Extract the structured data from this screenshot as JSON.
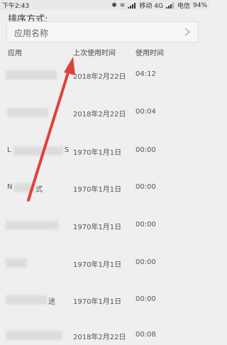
{
  "status_bar": {
    "time": "下午2:43",
    "carrier1": "移动 4G",
    "carrier2": "电信",
    "battery": "94%"
  },
  "sort": {
    "label": "排序方式:",
    "selected": "应用名称"
  },
  "columns": {
    "app": "应用",
    "last_used": "上次使用时间",
    "duration": "使用时间"
  },
  "rows": [
    {
      "name_visible": "",
      "date": "2018年2月22日",
      "duration": "04:12"
    },
    {
      "name_visible": "",
      "date": "2018年2月22日",
      "duration": "00:04"
    },
    {
      "name_visible": "L",
      "name_suffix": "S",
      "date": "1970年1月1日",
      "duration": "00:00"
    },
    {
      "name_visible": "N",
      "name_suffix": "式",
      "date": "1970年1月1日",
      "duration": "00:00"
    },
    {
      "name_visible": "",
      "date": "1970年1月1日",
      "duration": "00:00"
    },
    {
      "name_visible": "",
      "date": "1970年1月1日",
      "duration": "00:00"
    },
    {
      "name_visible": "",
      "name_suffix": "迷",
      "date": "1970年1月1日",
      "duration": "00:00"
    },
    {
      "name_visible": "",
      "date": "2018年2月22日",
      "duration": "00:08"
    }
  ],
  "colors": {
    "annotation_arrow": "#e0403a",
    "background": "#efefef"
  }
}
